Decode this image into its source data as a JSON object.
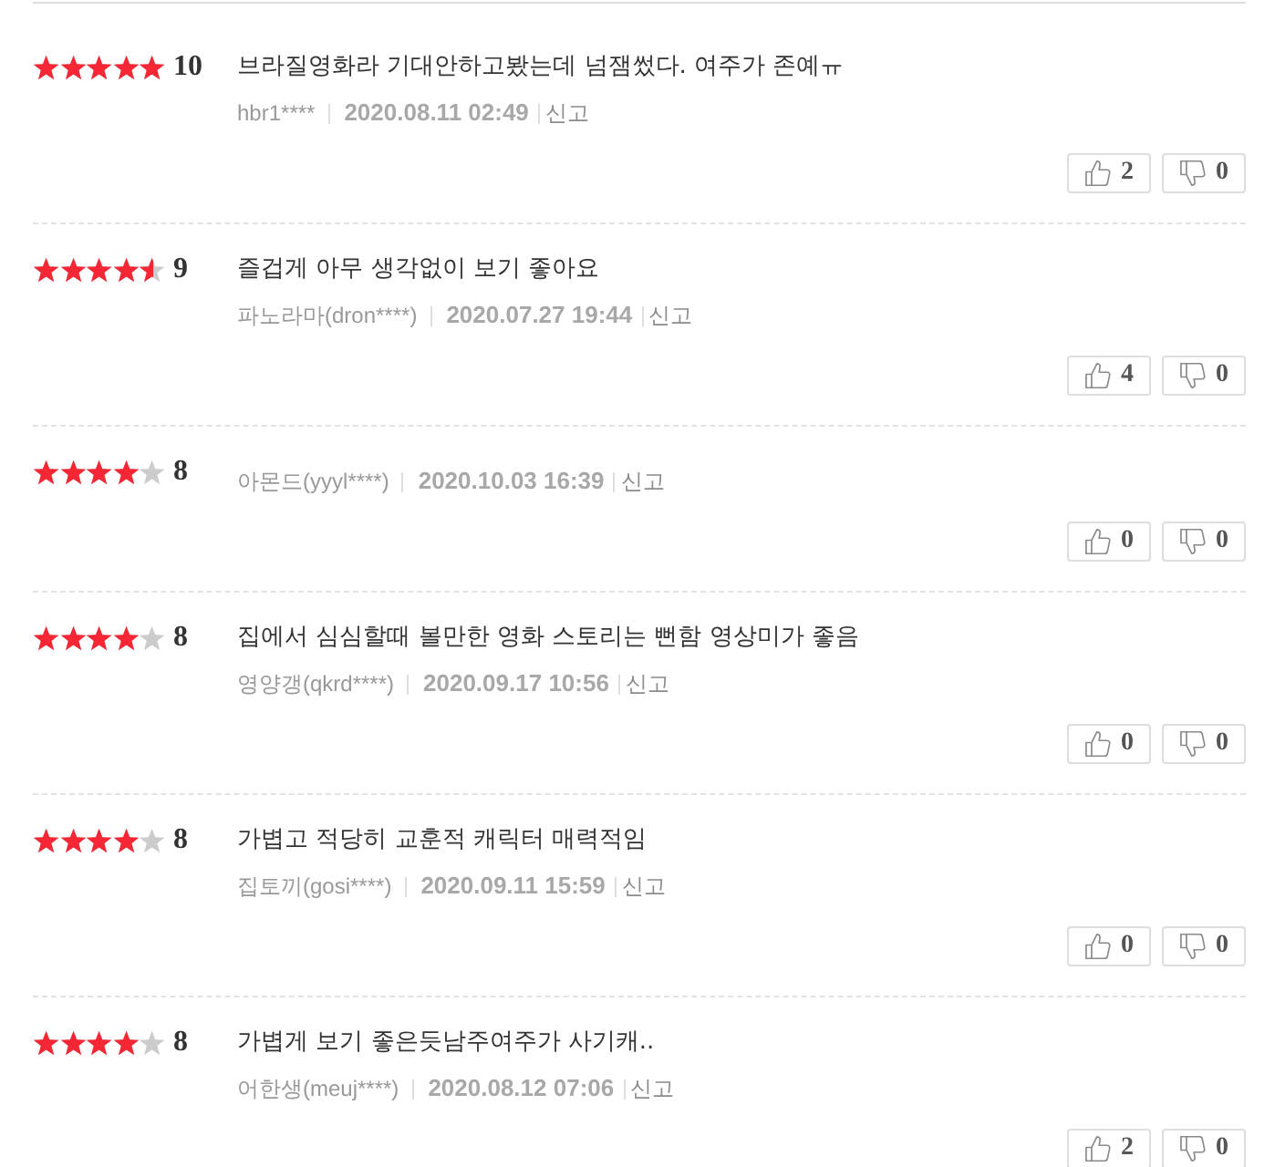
{
  "reviews": [
    {
      "stars": 5,
      "score": "10",
      "comment": "브라질영화라 기대안하고봤는데 넘잼썼다. 여주가 존예ㅠ",
      "author": "hbr1****",
      "date": "2020.08.11 02:49",
      "report": "신고",
      "likes": "2",
      "dislikes": "0"
    },
    {
      "stars": 4.5,
      "score": "9",
      "comment": "즐겁게 아무 생각없이 보기 좋아요",
      "author": "파노라마(dron****)",
      "date": "2020.07.27 19:44",
      "report": "신고",
      "likes": "4",
      "dislikes": "0"
    },
    {
      "stars": 4,
      "score": "8",
      "author": "아몬드(yyyl****)",
      "date": "2020.10.03 16:39",
      "report": "신고",
      "likes": "0",
      "dislikes": "0"
    },
    {
      "stars": 4,
      "score": "8",
      "comment": "집에서 심심할때 볼만한 영화 스토리는 뻔함 영상미가 좋음",
      "author": "영양갱(qkrd****)",
      "date": "2020.09.17 10:56",
      "report": "신고",
      "likes": "0",
      "dislikes": "0"
    },
    {
      "stars": 4,
      "score": "8",
      "comment": "가볍고 적당히 교훈적 캐릭터 매력적임",
      "author": "집토끼(gosi****)",
      "date": "2020.09.11 15:59",
      "report": "신고",
      "likes": "0",
      "dislikes": "0"
    },
    {
      "stars": 4,
      "score": "8",
      "comment": "가볍게 보기 좋은듯남주여주가 사기캐..",
      "author": "어한생(meuj****)",
      "date": "2020.08.12 07:06",
      "report": "신고",
      "likes": "2",
      "dislikes": "0"
    }
  ]
}
